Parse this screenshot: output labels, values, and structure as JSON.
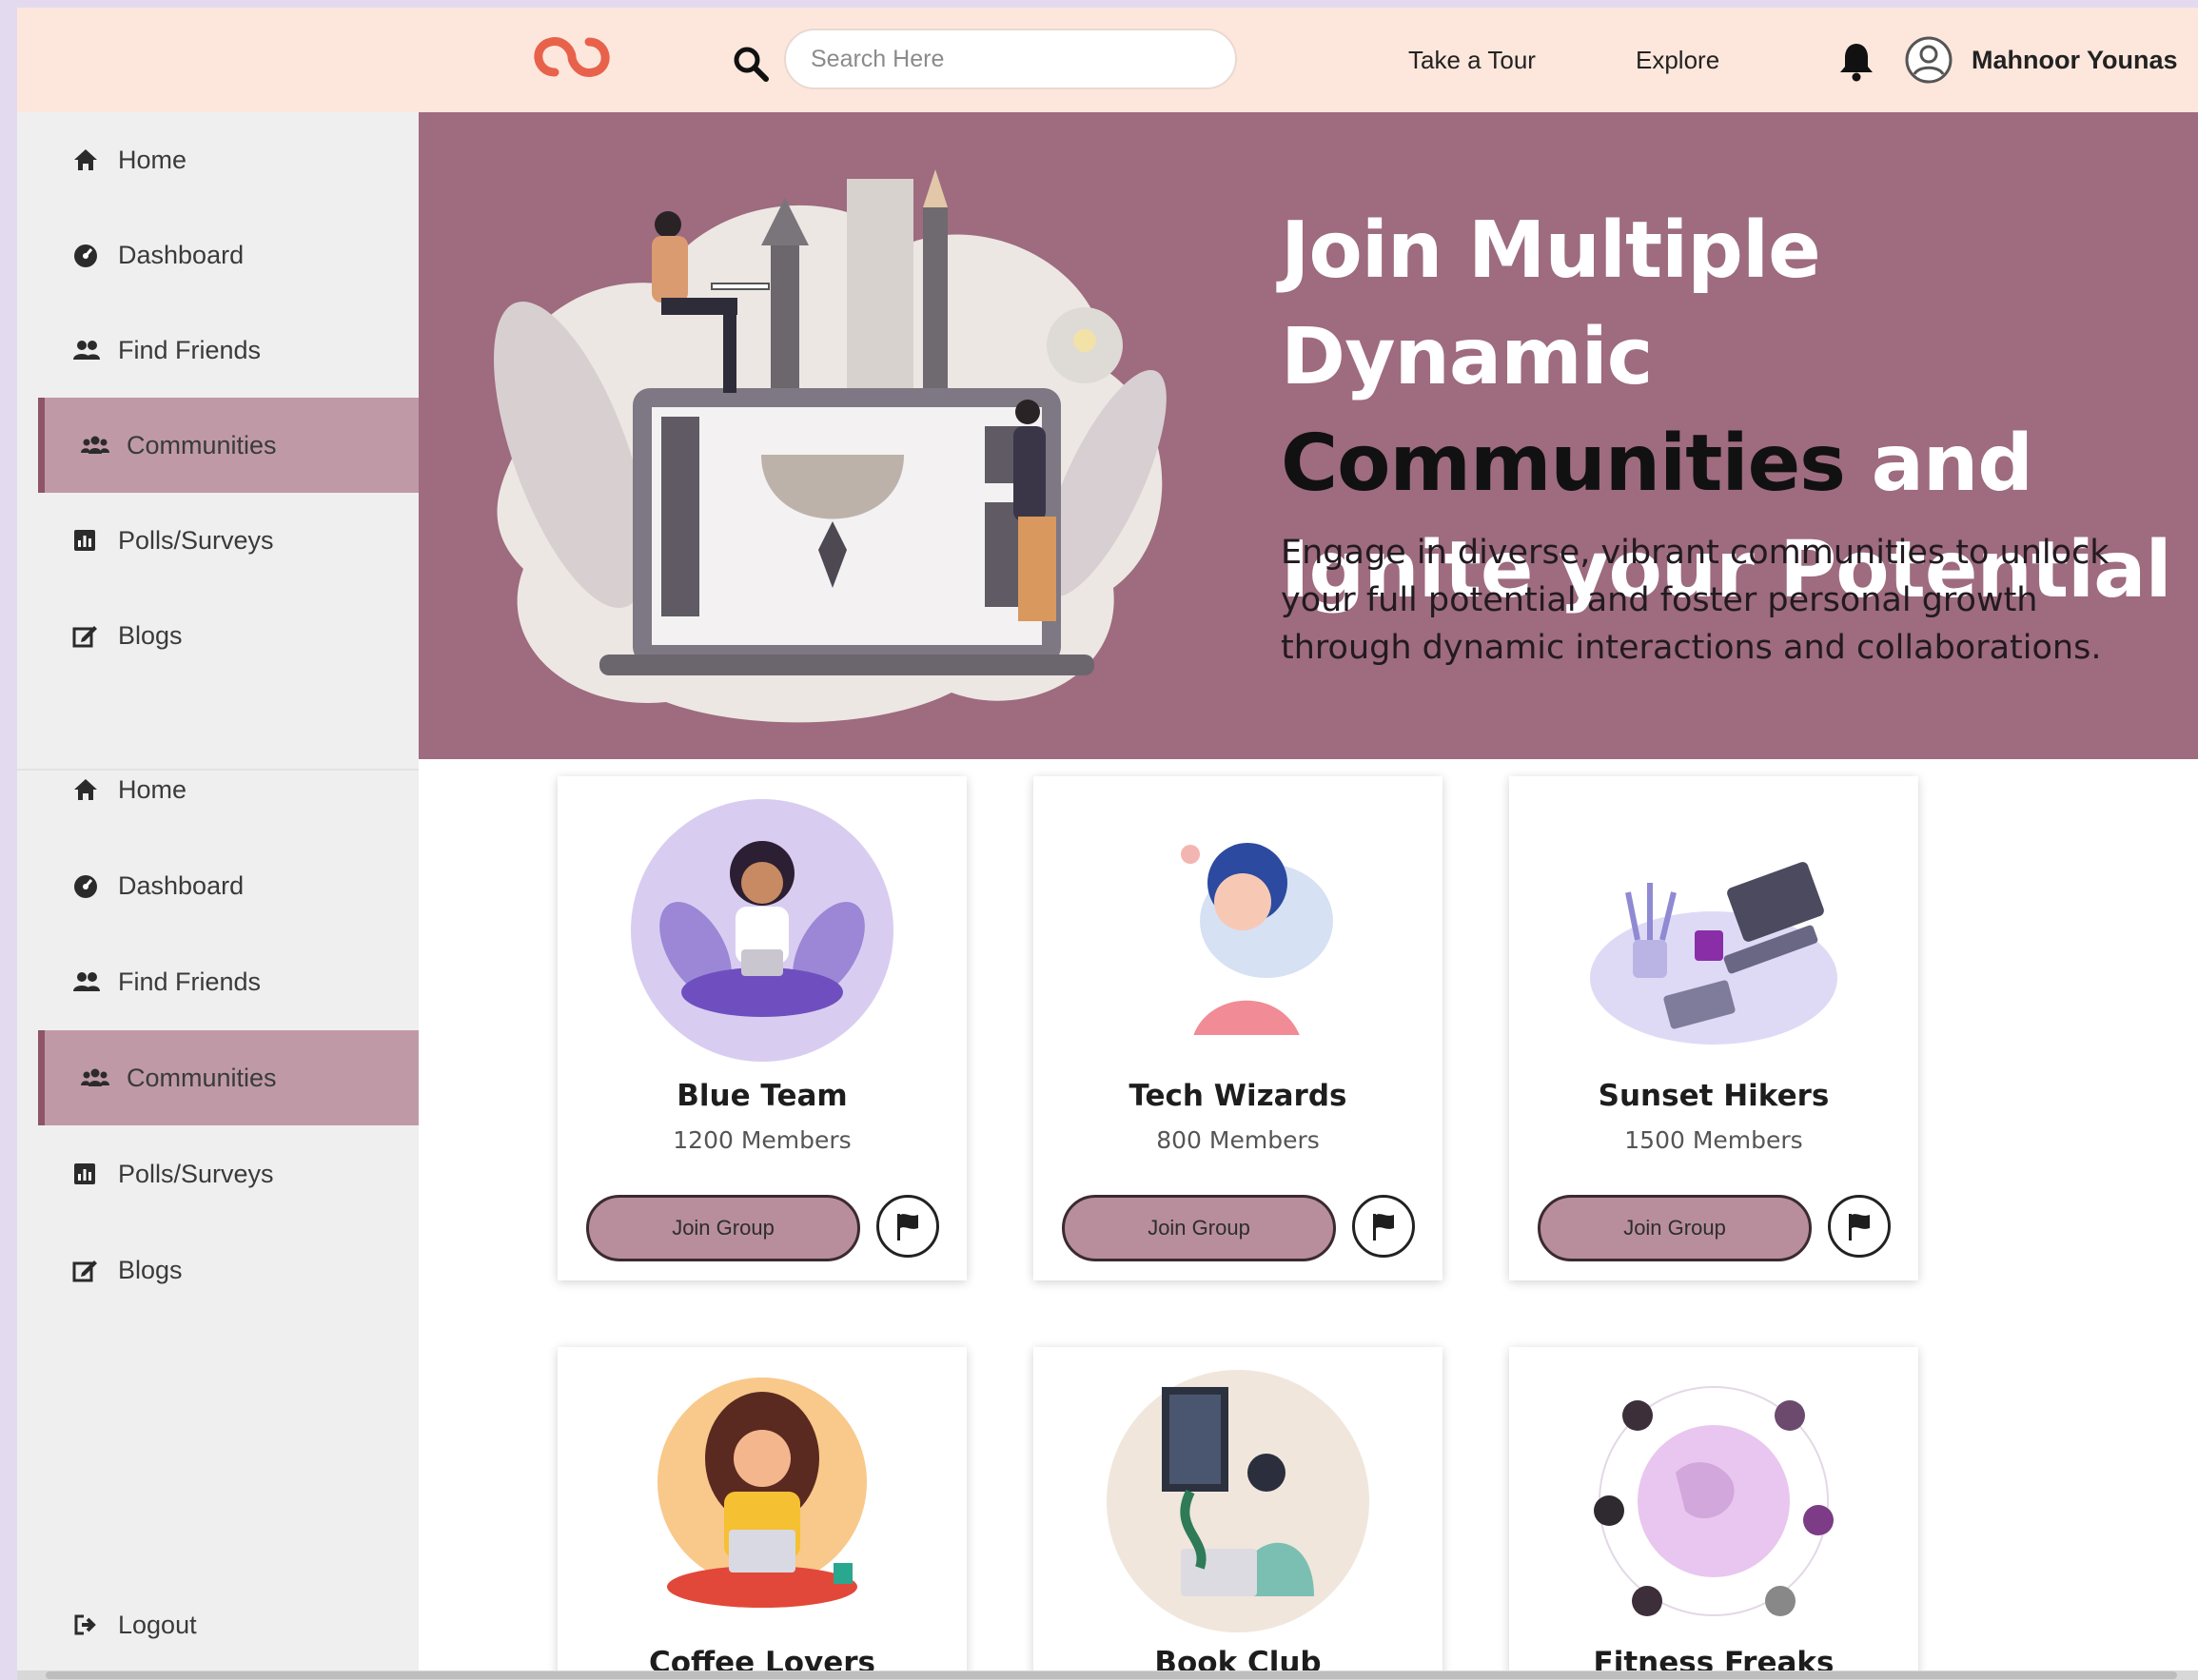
{
  "header": {
    "search_placeholder": "Search Here",
    "nav": [
      "Take a Tour",
      "Explore"
    ],
    "username": "Mahnoor Younas"
  },
  "sidebar_top": [
    {
      "label": "Home",
      "icon": "home-icon"
    },
    {
      "label": "Dashboard",
      "icon": "dashboard-icon"
    },
    {
      "label": "Find Friends",
      "icon": "friends-icon"
    },
    {
      "label": "Communities",
      "icon": "communities-icon",
      "active": true
    },
    {
      "label": "Polls/Surveys",
      "icon": "polls-icon"
    },
    {
      "label": "Blogs",
      "icon": "blogs-icon"
    }
  ],
  "sidebar_bottom": [
    {
      "label": "Home",
      "icon": "home-icon"
    },
    {
      "label": "Dashboard",
      "icon": "dashboard-icon"
    },
    {
      "label": "Find Friends",
      "icon": "friends-icon"
    },
    {
      "label": "Communities",
      "icon": "communities-icon",
      "active": true
    },
    {
      "label": "Polls/Surveys",
      "icon": "polls-icon"
    },
    {
      "label": "Blogs",
      "icon": "blogs-icon"
    }
  ],
  "logout_label": "Logout",
  "hero": {
    "title_part1": "Join Multiple Dynamic",
    "title_dark": "Communities",
    "title_part2": "and Ignite your Potential",
    "text": "Engage in diverse, vibrant communities to unlock your full potential and foster personal growth through dynamic interactions and collaborations."
  },
  "communities": [
    {
      "name": "Blue Team",
      "members": "1200 Members",
      "join_label": "Join Group"
    },
    {
      "name": "Tech Wizards",
      "members": "800 Members",
      "join_label": "Join Group"
    },
    {
      "name": "Sunset Hikers",
      "members": "1500 Members",
      "join_label": "Join Group"
    },
    {
      "name": "Coffee Lovers"
    },
    {
      "name": "Book Club"
    },
    {
      "name": "Fitness Freaks"
    }
  ],
  "colors": {
    "header_bg": "#fde7dc",
    "hero_bg": "#9e6b7f",
    "sidebar_bg": "#efefef",
    "active_item": "#bf9aa6",
    "button": "#b88e9c",
    "logo": "#e8624b"
  }
}
